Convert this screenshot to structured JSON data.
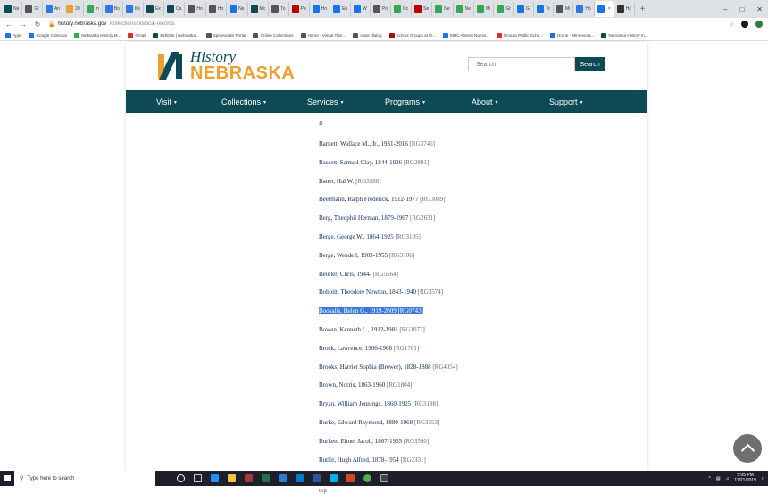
{
  "browser": {
    "tabs": [
      "Ne",
      "Gr",
      "An",
      "20",
      "m",
      "Bo",
      "Ke",
      "Ex",
      "Ca",
      "Ho",
      "Ho",
      "Ne",
      "Mc",
      "To",
      "Po",
      "Ho",
      "En",
      "W",
      "Po",
      "Dc",
      "Se",
      "Ne",
      "Ne",
      "Mi",
      "Gr",
      "Gr",
      "Tr",
      "Mi",
      "Ho",
      "",
      "Hc"
    ],
    "url_host": "history.nebraska.gov",
    "url_path": "/collections/political-records",
    "bookmarks": [
      "Apps",
      "Google Calendar",
      "Nebraska History M...",
      "Gmail",
      "Exhibits | Nebraska...",
      "Spiceworks Portal",
      "Online Collections",
      "Home - Visual Thin...",
      "close dialog",
      "School Groups at th...",
      "MHC Absent Narrat...",
      "Omaha Public Scho...",
      "Home - Minnesota...",
      "Nebraska History In..."
    ]
  },
  "site": {
    "logo_history": "History",
    "logo_nebraska": "NEBRASKA",
    "search_placeholder": "Search",
    "search_button": "Search",
    "nav": [
      "Visit",
      "Collections",
      "Services",
      "Programs",
      "About",
      "Support"
    ]
  },
  "content": {
    "letter": "B",
    "entries": [
      {
        "name": "Barnett, Wallace M., Jr., 1931-2016",
        "rg": "[RG3746]"
      },
      {
        "name": "Bassett, Samuel Clay, 1844-1926",
        "rg": "[RG2891]"
      },
      {
        "name": "Bauer, Hal W.",
        "rg": "[RG3588]"
      },
      {
        "name": "Beermann, Ralph Frederick, 1912-1977",
        "rg": "[RG3089]"
      },
      {
        "name": "Berg, Theophil Herman, 1879-1967",
        "rg": "[RG2631]"
      },
      {
        "name": "Berge, George W., 1864-1925",
        "rg": "[RG3105]"
      },
      {
        "name": "Berge, Wendell, 1903-1955",
        "rg": "[RG3106]"
      },
      {
        "name": "Beutler, Chris, 1944-",
        "rg": "[RG5564]"
      },
      {
        "name": "Bobbitt, Theodore Newton, 1843-1940",
        "rg": "[RG3574]"
      },
      {
        "name": "Boosalis, Helen G., 1919-2009",
        "rg": "[RG0743]"
      },
      {
        "name": "Bowen, Kenneth L., 1912-1981",
        "rg": "[RG1077]"
      },
      {
        "name": "Brock, Lawrence, 1906-1968",
        "rg": "[RG1781]"
      },
      {
        "name": "Brooks, Harriet Sophia (Brewer), 1828-1888",
        "rg": "[RG4054]"
      },
      {
        "name": "Brown, Norris, 1863-1960",
        "rg": "[RG1804]"
      },
      {
        "name": "Bryan, William Jennings, 1860-1925",
        "rg": "[RG3198]"
      },
      {
        "name": "Burke, Edward Raymond, 1880-1968",
        "rg": "[RG3253]"
      },
      {
        "name": "Burkett, Elmer Jacob, 1867-1935",
        "rg": "[RG3590]"
      },
      {
        "name": "Butler, Hugh Alfred, 1878-1954",
        "rg": "[RG2331]"
      }
    ],
    "top_link": "top",
    "selected_index": 9
  },
  "taskbar": {
    "search_placeholder": "Type here to search",
    "time": "5:05 PM",
    "date": "11/21/2019"
  },
  "colors": {
    "brand_teal": "#0d4a56",
    "brand_orange": "#f0a02e",
    "selection": "#3b78d8"
  }
}
